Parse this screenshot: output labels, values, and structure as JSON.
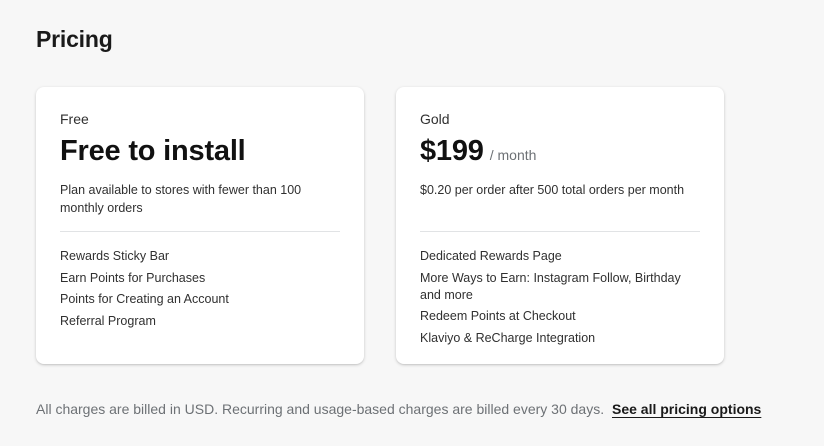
{
  "page": {
    "title": "Pricing"
  },
  "plans": [
    {
      "name": "Free",
      "price": "Free to install",
      "unit": "",
      "description": "Plan available to stores with fewer than 100 monthly orders",
      "features": [
        "Rewards Sticky Bar",
        "Earn Points for Purchases",
        "Points for Creating an Account",
        "Referral Program"
      ]
    },
    {
      "name": "Gold",
      "price": "$199",
      "unit": "/ month",
      "description": "$0.20 per order after 500 total orders per month",
      "features": [
        "Dedicated Rewards Page",
        "More Ways to Earn: Instagram Follow, Birthday and more",
        "Redeem Points at Checkout",
        "Klaviyo & ReCharge Integration"
      ]
    }
  ],
  "footer": {
    "note": "All charges are billed in USD. Recurring and usage-based charges are billed every 30 days.",
    "link_label": "See all pricing options"
  }
}
